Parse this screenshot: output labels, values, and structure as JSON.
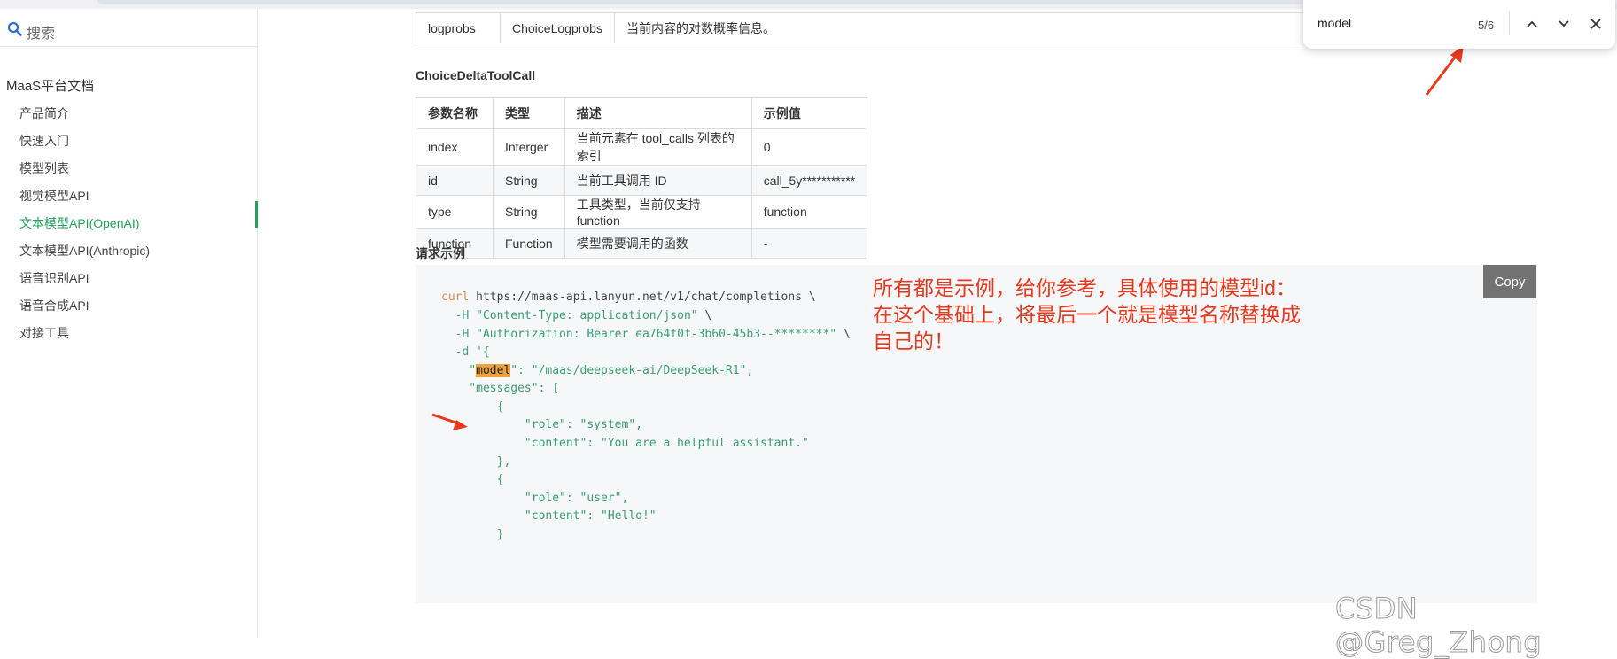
{
  "sidebar": {
    "search_label": "搜索",
    "nav_title": "MaaS平台文档",
    "items": [
      {
        "label": "产品简介"
      },
      {
        "label": "快速入门"
      },
      {
        "label": "模型列表"
      },
      {
        "label": "视觉模型API"
      },
      {
        "label": "文本模型API(OpenAI)"
      },
      {
        "label": "文本模型API(Anthropic)"
      },
      {
        "label": "语音识别API"
      },
      {
        "label": "语音合成API"
      },
      {
        "label": "对接工具"
      }
    ],
    "active_index": 4
  },
  "top_table": {
    "row": [
      "logprobs",
      "ChoiceLogprobs",
      "当前内容的对数概率信息。"
    ]
  },
  "tool_call_section": {
    "heading": "ChoiceDeltaToolCall",
    "headers": [
      "参数名称",
      "类型",
      "描述",
      "示例值"
    ],
    "rows": [
      [
        "index",
        "Interger",
        "当前元素在 tool_calls 列表的索引",
        "0"
      ],
      [
        "id",
        "String",
        "当前工具调用 ID",
        "call_5y***********"
      ],
      [
        "type",
        "String",
        "工具类型，当前仅支持function",
        "function"
      ],
      [
        "function",
        "Function",
        "模型需要调用的函数",
        "-"
      ]
    ]
  },
  "request_example": {
    "heading": "请求示例",
    "copy_label": "Copy",
    "code": {
      "l1_cmd": "curl",
      "l1_rest": " https://maas-api.lanyun.net/v1/chat/completions \\",
      "l2_flag": "  -H",
      "l2_str": " \"Content-Type: application/json\"",
      "l2_end": " \\",
      "l3_flag": "  -H",
      "l3_str": " \"Authorization: Bearer ea764f0f-3b60-45b3--********\"",
      "l3_end": " \\",
      "l4_flag": "  -d",
      "l4_str": " '{",
      "l5_pre": "    \"",
      "l5_hl": "model",
      "l5_post": "\": \"/maas/deepseek-ai/DeepSeek-R1\",",
      "l6": "    \"messages\": [",
      "l7": "        {",
      "l8": "            \"role\": \"system\",",
      "l9": "            \"content\": \"You are a helpful assistant.\"",
      "l10": "        },",
      "l11": "        {",
      "l12": "            \"role\": \"user\",",
      "l13": "            \"content\": \"Hello!\"",
      "l14": "        }"
    }
  },
  "annotation": {
    "line1": "所有都是示例，给你参考，具体使用的模型id：",
    "line2": "在这个基础上，将最后一个就是模型名称替换成",
    "line3": "自己的！",
    "color": "#e8391f"
  },
  "find_bar": {
    "query": "model",
    "count": "5/6"
  },
  "watermark": "CSDN @Greg_Zhong",
  "colors": {
    "accent": "#22a35b",
    "highlight": "#f0a23a",
    "code_bg": "#f6f7f8",
    "copy_button": "#727272"
  }
}
